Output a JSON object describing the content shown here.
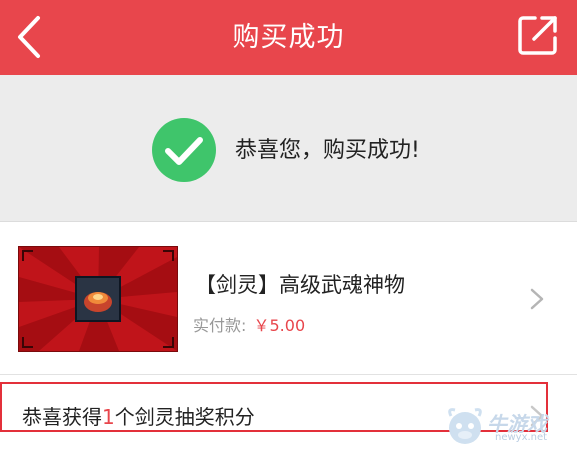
{
  "header": {
    "title": "购买成功",
    "back_icon": "chevron-left-icon",
    "share_icon": "share-external-icon"
  },
  "success": {
    "message": "恭喜您，购买成功!",
    "icon": "check-circle-icon",
    "icon_color": "#3fc56b"
  },
  "product": {
    "title": "【剑灵】高级武魂神物",
    "price_label": "实付款:",
    "price": "￥5.00"
  },
  "reward": {
    "prefix": "恭喜获得",
    "count": "1",
    "suffix": "个剑灵抽奖积分"
  },
  "watermark": {
    "brand": "牛游戏",
    "domain": "newyx.net"
  },
  "colors": {
    "accent": "#e8464c",
    "success": "#3fc56b"
  }
}
